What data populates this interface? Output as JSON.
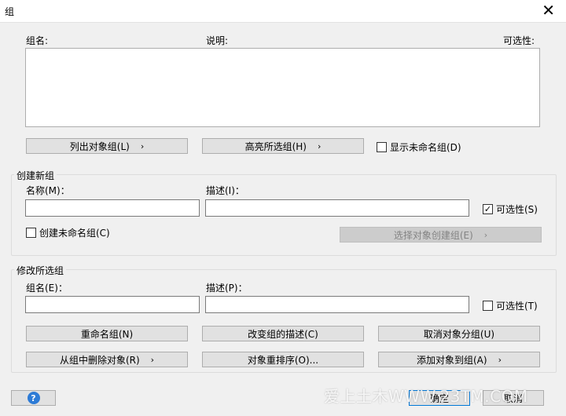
{
  "window": {
    "title": "组",
    "close": "✕"
  },
  "list_header": {
    "name": "组名:",
    "desc": "说明:",
    "visible": "可选性:"
  },
  "top_buttons": {
    "list_objects": "列出对象组(L)",
    "highlight": "高亮所选组(H)",
    "show_unnamed": "显示未命名组(D)",
    "show_unnamed_checked": false
  },
  "create_group": {
    "title": "创建新组",
    "name_label": "名称(M)：",
    "desc_label": "描述(I)：",
    "name_value": "",
    "desc_value": "",
    "selectable_label": "可选性(S)",
    "selectable_checked": true,
    "unnamed_label": "创建未命名组(C)",
    "unnamed_checked": false,
    "select_create_btn": "选择对象创建组(E)"
  },
  "modify_group": {
    "title": "修改所选组",
    "name_label": "组名(E)：",
    "desc_label": "描述(P)：",
    "name_value": "",
    "desc_value": "",
    "selectable_label": "可选性(T)",
    "selectable_checked": false,
    "buttons": {
      "rename": "重命名组(N)",
      "change_desc": "改变组的描述(C)",
      "ungroup": "取消对象分组(U)",
      "remove": "从组中删除对象(R)",
      "reorder": "对象重排序(O)...",
      "add": "添加对象到组(A)"
    }
  },
  "footer": {
    "help_icon": "?",
    "ok": "确定",
    "cancel": "取消"
  },
  "watermark": "爱上土木WWW.23TM.COM",
  "icons": {
    "arrow": "›",
    "check": "✓"
  }
}
